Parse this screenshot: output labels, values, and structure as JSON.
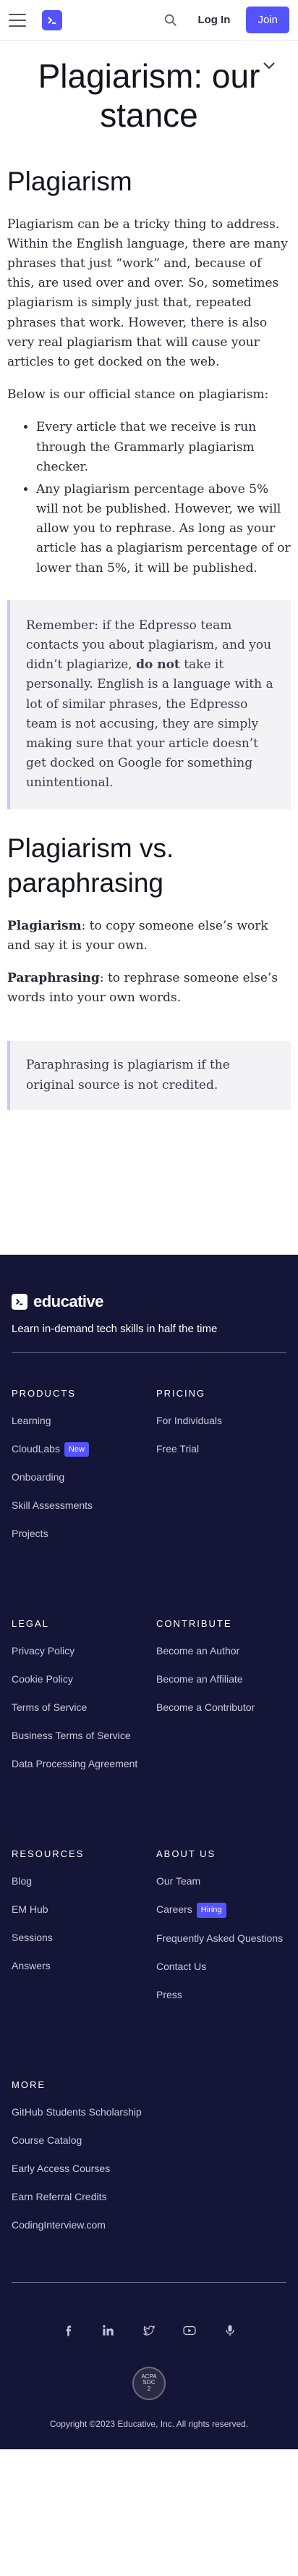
{
  "header": {
    "login_label": "Log In",
    "join_label": "Join"
  },
  "article": {
    "title": "Plagiarism: our stance",
    "section1_heading": "Plagiarism",
    "intro_paragraph": "Plagiarism can be a tricky thing to address. Within the English language, there are many phrases that just “work” and, because of this, are used over and over. So, sometimes plagiarism is simply just that, repeated phrases that work. However, there is also very real plagiarism that will cause your articles to get docked on the web.",
    "stance_intro": "Below is our official stance on plagiarism:",
    "bullets": [
      "Every article that we receive is run through the Grammarly plagiarism checker.",
      "Any plagiarism percentage above 5% will not be published. However, we will allow you to rephrase. As long as your article has a plagiarism percentage of or lower than 5%, it will be published."
    ],
    "callout": {
      "before": "Remember: if the Edpresso team contacts you about plagiarism, and you didn’t plagiarize, ",
      "bold": "do not",
      "after": " take it personally. English is a language with a lot of similar phrases, the Edpresso team is not accusing, they are simply making sure that your article doesn’t get docked on Google for something unintentional."
    },
    "section2_heading": "Plagiarism vs. paraphrasing",
    "def1_term": "Plagiarism",
    "def1_text": ": to copy someone else’s work and say it is your own.",
    "def2_term": "Paraphrasing",
    "def2_text": ": to rephrase someone else’s words into your own words.",
    "callout2": "Paraphrasing is plagiarism if the original source is not credited."
  },
  "footer": {
    "brand": "educative",
    "tagline": "Learn in-demand tech skills in half the time",
    "products": {
      "heading": "PRODUCTS",
      "links": [
        "Learning",
        "CloudLabs",
        "Onboarding",
        "Skill Assessments",
        "Projects"
      ],
      "cloudlabs_badge": "New"
    },
    "pricing": {
      "heading": "PRICING",
      "links": [
        "For Individuals",
        "Free Trial"
      ]
    },
    "legal": {
      "heading": "LEGAL",
      "links": [
        "Privacy Policy",
        "Cookie Policy",
        "Terms of Service",
        "Business Terms of Service",
        "Data Processing Agreement"
      ]
    },
    "contribute": {
      "heading": "CONTRIBUTE",
      "links": [
        "Become an Author",
        "Become an Affiliate",
        "Become a Contributor"
      ]
    },
    "resources": {
      "heading": "RESOURCES",
      "links": [
        "Blog",
        "EM Hub",
        "Sessions",
        "Answers"
      ]
    },
    "about": {
      "heading": "ABOUT US",
      "links": [
        "Our Team",
        "Careers",
        "Frequently Asked Questions",
        "Contact Us",
        "Press"
      ],
      "careers_badge": "Hiring"
    },
    "more": {
      "heading": "MORE",
      "links": [
        "GitHub Students Scholarship",
        "Course Catalog",
        "Early Access Courses",
        "Earn Referral Credits",
        "CodingInterview.com"
      ]
    },
    "acpa_badge_lines": [
      "ACPA",
      "SOC",
      "2"
    ],
    "copyright": "Copyright ©2023 Educative, Inc. All rights reserved."
  },
  "colors": {
    "brand": "#5553ff",
    "footer_bg": "#151538"
  },
  "icons": [
    "hamburger-icon",
    "educative-logo-icon",
    "search-icon",
    "chevron-down-icon",
    "facebook-icon",
    "linkedin-icon",
    "twitter-icon",
    "youtube-icon",
    "podcast-icon"
  ]
}
